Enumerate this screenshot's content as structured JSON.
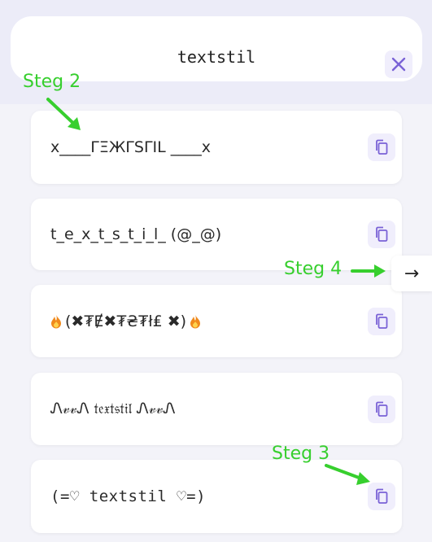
{
  "search": {
    "value": "textstil"
  },
  "icons": {
    "close": "close-icon",
    "copy": "copy-icon",
    "next": "arrow-right-icon",
    "flame": "fire-emoji"
  },
  "colors": {
    "accent": "#7a62d6",
    "annotation": "#37cf2e"
  },
  "results": [
    {
      "text": "x____ΓΞЖΓSΓIL ____x"
    },
    {
      "text": "t_e_x_t_s_t_i_l_ (@_@)"
    },
    {
      "text": "(✖₮Ɇ✖₮₴₮ł₤ ✖)"
    },
    {
      "text": "Ꮑ𝓋𝓋Ꮑ 𝔱𝔢𝔵𝔱𝔰𝔱𝔦𝔩 Ꮑ𝓋𝓋Ꮑ"
    },
    {
      "text": "(=♡ textstil ♡=)"
    }
  ],
  "next_button": {
    "label": "→"
  },
  "annotations": {
    "step2": "Steg 2",
    "step3": "Steg 3",
    "step4": "Steg 4"
  }
}
